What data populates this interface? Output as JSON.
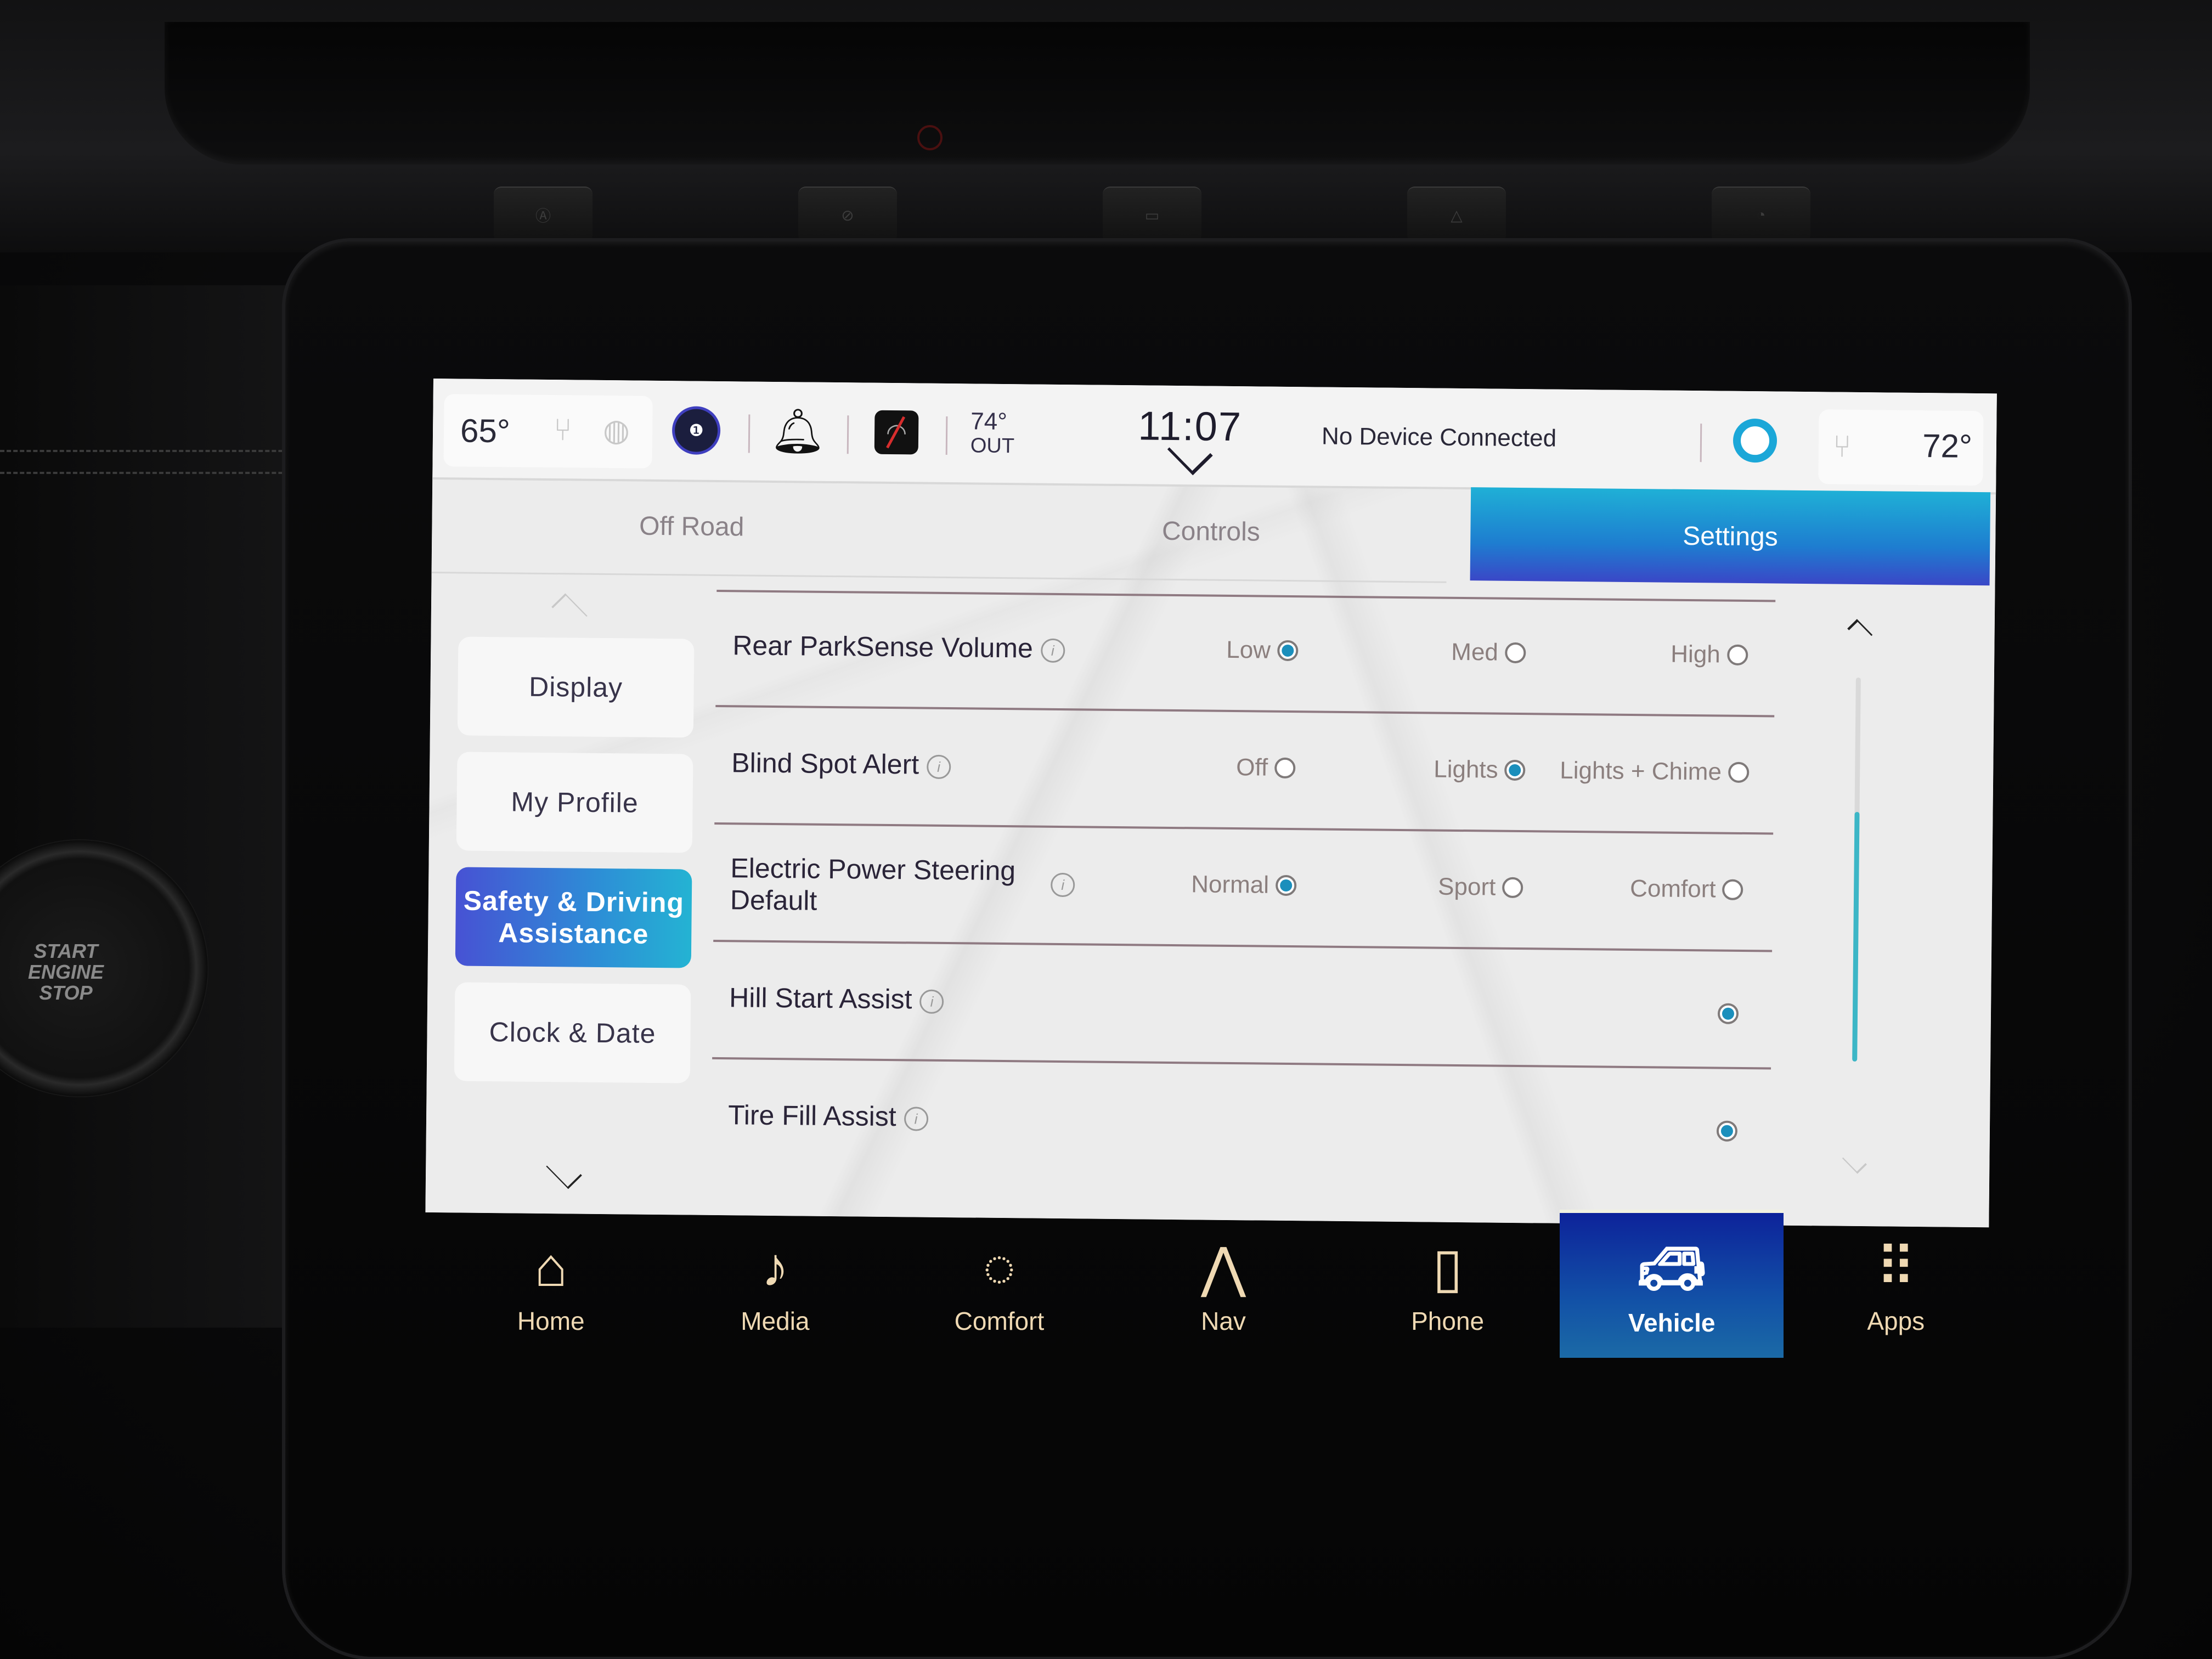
{
  "status_bar": {
    "driver_temp": "65°",
    "outside_temp": "74°",
    "outside_label": "OUT",
    "time": "11:07",
    "device_status": "No Device Connected",
    "passenger_temp": "72°",
    "icons": {
      "driver_seat_heat": "heated-seat-icon",
      "steering_heat": "heated-steering-wheel-icon",
      "driver_profile": "driver-profile-icon",
      "notifications": "bell-icon",
      "wifi": "wifi-off-icon",
      "assistant": "alexa-icon",
      "passenger_seat_heat": "heated-seat-icon"
    }
  },
  "tabs": [
    {
      "label": "Off Road",
      "active": false
    },
    {
      "label": "Controls",
      "active": false
    },
    {
      "label": "Settings",
      "active": true
    }
  ],
  "side_menu": {
    "items": [
      {
        "label": "Display",
        "active": false
      },
      {
        "label": "My Profile",
        "active": false
      },
      {
        "label": "Safety & Driving Assistance",
        "active": true
      },
      {
        "label": "Clock & Date",
        "active": false
      }
    ]
  },
  "settings": [
    {
      "label": "Rear ParkSense Volume",
      "options": [
        {
          "label": "Low",
          "selected": true
        },
        {
          "label": "Med",
          "selected": false
        },
        {
          "label": "High",
          "selected": false
        }
      ]
    },
    {
      "label": "Blind Spot Alert",
      "options": [
        {
          "label": "Off",
          "selected": false
        },
        {
          "label": "Lights",
          "selected": true
        },
        {
          "label": "Lights + Chime",
          "selected": false
        }
      ]
    },
    {
      "label": "Electric Power Steering Default",
      "options": [
        {
          "label": "Normal",
          "selected": true
        },
        {
          "label": "Sport",
          "selected": false
        },
        {
          "label": "Comfort",
          "selected": false
        }
      ]
    },
    {
      "label": "Hill Start Assist",
      "enabled": true
    },
    {
      "label": "Tire Fill Assist",
      "enabled": true
    }
  ],
  "scrollbar": {
    "thumb_start_fraction": 0.35,
    "thumb_end_fraction": 1.0
  },
  "bottom_nav": [
    {
      "label": "Home",
      "icon": "home-icon",
      "active": false
    },
    {
      "label": "Media",
      "icon": "music-note-icon",
      "active": false
    },
    {
      "label": "Comfort",
      "icon": "comfort-seat-icon",
      "active": false
    },
    {
      "label": "Nav",
      "icon": "navigation-arrow-icon",
      "active": false
    },
    {
      "label": "Phone",
      "icon": "phone-icon",
      "active": false
    },
    {
      "label": "Vehicle",
      "icon": "vehicle-icon",
      "active": true
    },
    {
      "label": "Apps",
      "icon": "apps-grid-icon",
      "active": false
    }
  ],
  "dashboard": {
    "start_button_text": "START ENGINE STOP"
  },
  "colors": {
    "accent_blue": "#1ba7d8",
    "active_gradient_start": "#4752d4",
    "active_gradient_end": "#24b3d3",
    "nav_text": "#efd9b3",
    "radio_selected": "#1b8fbc",
    "scroll_thumb": "#3cb6c6"
  }
}
